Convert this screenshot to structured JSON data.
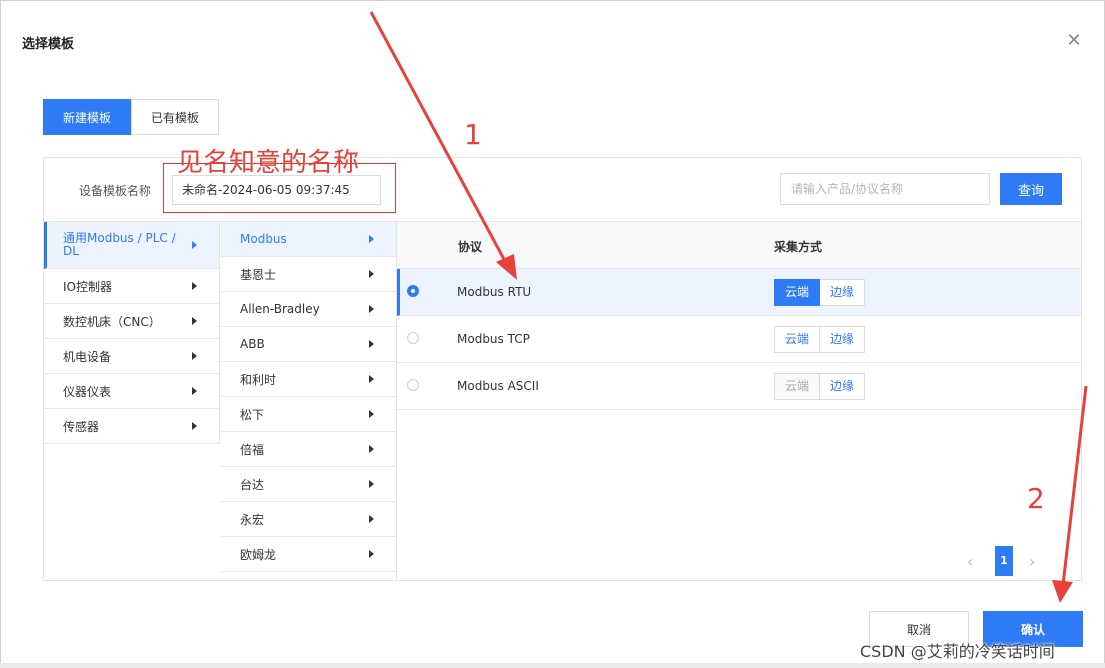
{
  "dialog": {
    "title": "选择模板",
    "close_icon": "close-icon"
  },
  "mode_tabs": [
    {
      "label": "新建模板",
      "active": true
    },
    {
      "label": "已有模板",
      "active": false
    }
  ],
  "template_name": {
    "label": "设备模板名称",
    "value": "未命名-2024-06-05 09:37:45"
  },
  "search": {
    "placeholder": "请输入产品/协议名称",
    "button_label": "查询"
  },
  "categories": [
    {
      "label": "通用Modbus / PLC / DL",
      "active": true
    },
    {
      "label": "IO控制器",
      "active": false
    },
    {
      "label": "数控机床（CNC）",
      "active": false
    },
    {
      "label": "机电设备",
      "active": false
    },
    {
      "label": "仪器仪表",
      "active": false
    },
    {
      "label": "传感器",
      "active": false
    }
  ],
  "vendors": [
    {
      "label": "Modbus",
      "active": true
    },
    {
      "label": "基恩士",
      "active": false
    },
    {
      "label": "Allen-Bradley",
      "active": false
    },
    {
      "label": "ABB",
      "active": false
    },
    {
      "label": "和利时",
      "active": false
    },
    {
      "label": "松下",
      "active": false
    },
    {
      "label": "倍福",
      "active": false
    },
    {
      "label": "台达",
      "active": false
    },
    {
      "label": "永宏",
      "active": false
    },
    {
      "label": "欧姆龙",
      "active": false
    }
  ],
  "protocol_table": {
    "columns": {
      "protocol": "协议",
      "method": "采集方式"
    },
    "rows": [
      {
        "name": "Modbus RTU",
        "selected": true,
        "methods": [
          {
            "label": "云端",
            "state": "active"
          },
          {
            "label": "边缘",
            "state": "normal"
          }
        ]
      },
      {
        "name": "Modbus TCP",
        "selected": false,
        "methods": [
          {
            "label": "云端",
            "state": "normal"
          },
          {
            "label": "边缘",
            "state": "normal"
          }
        ]
      },
      {
        "name": "Modbus ASCII",
        "selected": false,
        "methods": [
          {
            "label": "云端",
            "state": "disabled"
          },
          {
            "label": "边缘",
            "state": "normal"
          }
        ]
      }
    ]
  },
  "pagination": {
    "current_page": "1",
    "prev_glyph": "‹",
    "next_glyph": "›"
  },
  "footer": {
    "cancel_label": "取消",
    "confirm_label": "确认"
  },
  "annotations": {
    "hint": "见名知意的名称",
    "step1": "1",
    "step2": "2"
  },
  "watermark": "CSDN @艾莉的冷笑话时间",
  "colors": {
    "primary": "#2f7bf5",
    "annotation_red": "#e8413b"
  }
}
